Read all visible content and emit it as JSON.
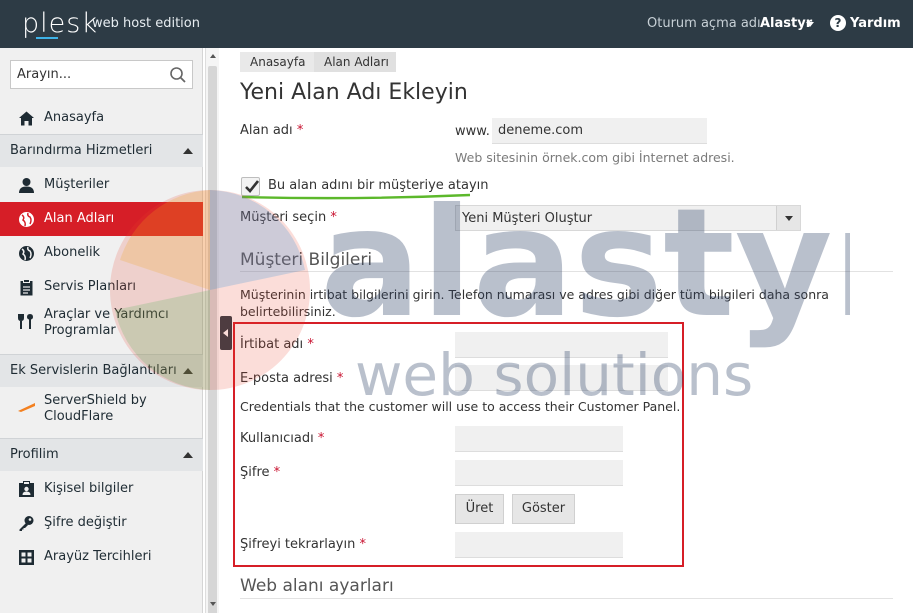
{
  "header": {
    "logo": "plesk",
    "edition": "web host edition",
    "login_label": "Oturum açma adı",
    "login_user": "Alastyr",
    "help_label": "Yardım"
  },
  "sidebar": {
    "search_placeholder": "Arayın...",
    "home": "Anasayfa",
    "sections": [
      {
        "title": "Barındırma Hizmetleri",
        "items": [
          "Müşteriler",
          "Alan Adları",
          "Abonelik",
          "Servis Planları",
          "Araçlar ve Yardımcı Programlar"
        ]
      },
      {
        "title": "Ek Servislerin Bağlantıları",
        "items": [
          "ServerShield by CloudFlare"
        ]
      },
      {
        "title": "Profilim",
        "items": [
          "Kişisel bilgiler",
          "Şifre değiştir",
          "Arayüz Tercihleri"
        ]
      }
    ],
    "active_item": "Alan Adları"
  },
  "breadcrumb": [
    "Anasayfa",
    "Alan Adları"
  ],
  "page_title": "Yeni Alan Adı Ekleyin",
  "form": {
    "domain_label": "Alan adı",
    "www_prefix": "www.",
    "domain_value": "deneme.com",
    "domain_hint": "Web sitesinin örnek.com gibi İnternet adresi.",
    "assign_checkbox_label": "Bu alan adını bir müşteriye atayın",
    "assign_checked": true,
    "customer_select_label": "Müşteri seçin",
    "customer_select_value": "Yeni Müşteri Oluştur",
    "customer_info_title": "Müşteri Bilgileri",
    "customer_info_desc": "Müşterinin irtibat bilgilerini girin. Telefon numarası ve adres gibi diğer tüm bilgileri daha sonra belirtebilirsiniz.",
    "contact_name_label": "İrtibat adı",
    "email_label": "E-posta adresi",
    "credentials_desc": "Credentials that the customer will use to access their Customer Panel.",
    "username_label": "Kullanıcıadı",
    "password_label": "Şifre",
    "generate_button": "Üret",
    "show_button": "Göster",
    "password_repeat_label": "Şifreyi tekrarlayın",
    "required_mark": "*",
    "web_settings_title": "Web alanı ayarları"
  },
  "watermark": {
    "brand": "alastyr",
    "tagline": "web solutions"
  },
  "colors": {
    "header_bg": "#2d3b45",
    "active_nav": "#d61e27",
    "required": "#c8102e",
    "highlight_frame": "#d61e27",
    "underline_green": "#5cb82b"
  }
}
